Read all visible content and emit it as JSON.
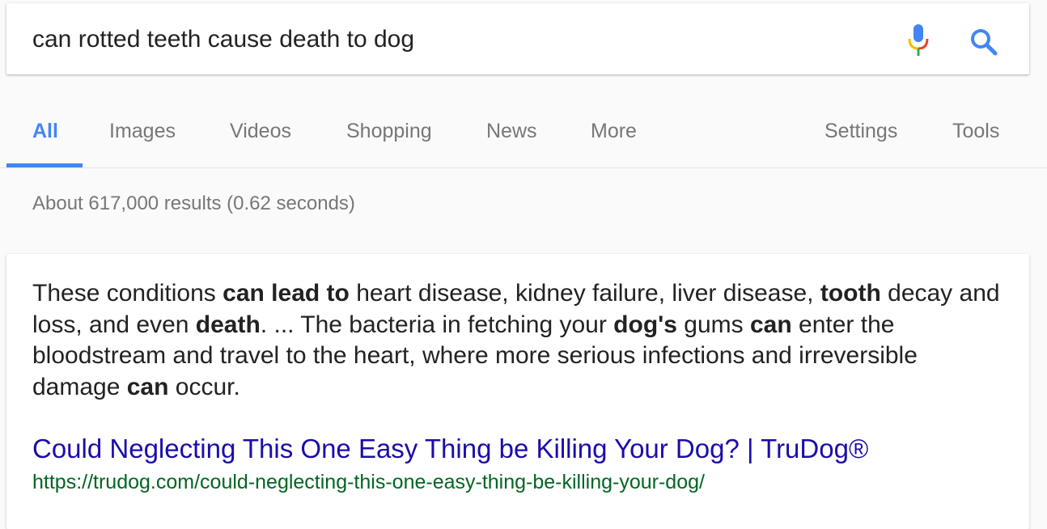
{
  "search": {
    "query": "can rotted teeth cause death to dog"
  },
  "icons": {
    "mic": "microphone-icon",
    "search": "search-icon",
    "mic_colors": [
      "#4285f4",
      "#ea4335",
      "#fbbc05",
      "#34a853"
    ],
    "search_color": "#4285f4"
  },
  "tabs": {
    "items": [
      {
        "label": "All",
        "active": true
      },
      {
        "label": "Images"
      },
      {
        "label": "Videos"
      },
      {
        "label": "Shopping"
      },
      {
        "label": "News"
      },
      {
        "label": "More"
      }
    ],
    "settings": "Settings",
    "tools": "Tools",
    "active_color": "#4285f4"
  },
  "stats": {
    "text": "About 617,000 results (0.62 seconds)"
  },
  "featured_snippet": {
    "segments": [
      {
        "text": "These conditions "
      },
      {
        "text": "can lead to",
        "bold": true
      },
      {
        "text": " heart disease, kidney failure, liver disease, "
      },
      {
        "text": "tooth",
        "bold": true
      },
      {
        "text": " decay and loss, and even "
      },
      {
        "text": "death",
        "bold": true
      },
      {
        "text": ". ... The bacteria in fetching your "
      },
      {
        "text": "dog's",
        "bold": true
      },
      {
        "text": " gums "
      },
      {
        "text": "can",
        "bold": true
      },
      {
        "text": " enter the bloodstream and travel to the heart, where more serious infections and irreversible damage "
      },
      {
        "text": "can",
        "bold": true
      },
      {
        "text": " occur."
      }
    ],
    "title": "Could Neglecting This One Easy Thing be Killing Your Dog? | TruDog®",
    "url": "https://trudog.com/could-neglecting-this-one-easy-thing-be-killing-your-dog/",
    "title_color": "#1a0dab",
    "url_color": "#006621"
  }
}
